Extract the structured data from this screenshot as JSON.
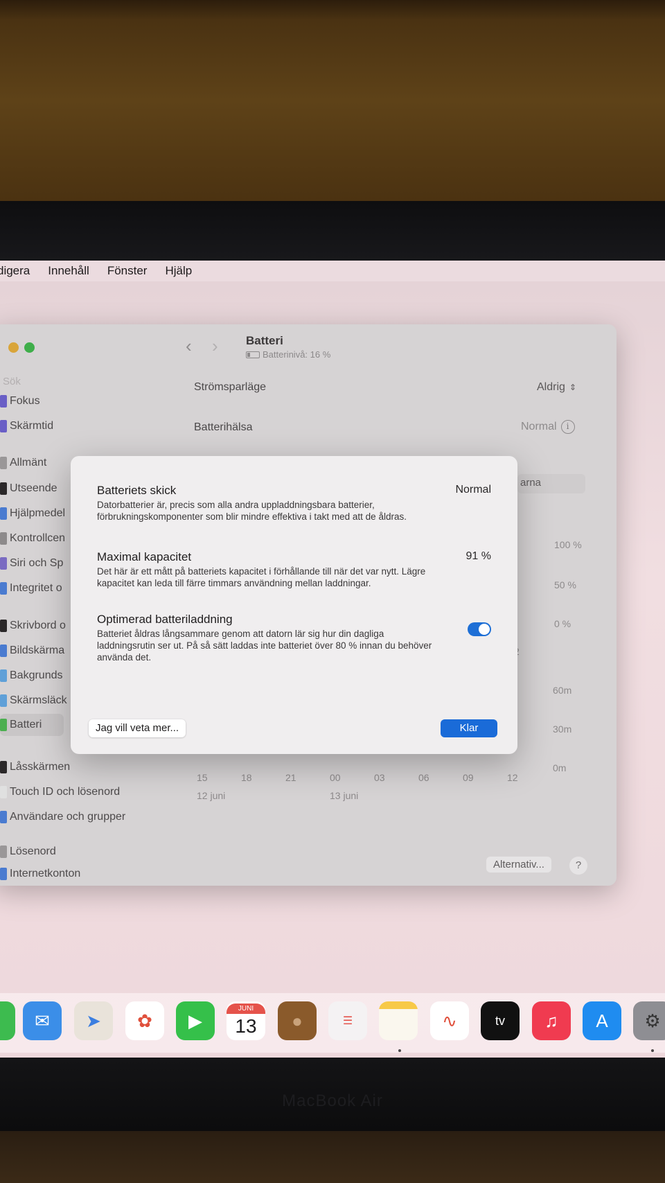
{
  "menubar": [
    "digera",
    "Innehåll",
    "Fönster",
    "Hjälp"
  ],
  "window": {
    "title": "Batteri",
    "subtitle": "Batterinivå: 16 %",
    "search_placeholder": "Sök",
    "sidebar": [
      "Fokus",
      "Skärmtid",
      "Allmänt",
      "Utseende",
      "Hjälpmedel",
      "Kontrollcen",
      "Siri och Sp",
      "Integritet o",
      "Skrivbord o",
      "Bildskärma",
      "Bakgrunds",
      "Skärmsläck",
      "Batteri",
      "Låsskärmen",
      "Touch ID och lösenord",
      "Användare och grupper",
      "Lösenord",
      "Internetkonton"
    ],
    "low_power_label": "Strömsparläge",
    "low_power_value": "Aldrig",
    "health_label": "Batterihälsa",
    "health_value": "Normal",
    "partial_label": "arna",
    "chart": {
      "level_ticks": [
        "100 %",
        "50 %",
        "0 %"
      ],
      "usage_ticks": [
        "60m",
        "30m",
        "0m"
      ],
      "hours": [
        "15",
        "18",
        "21",
        "00",
        "03",
        "06",
        "09",
        "12"
      ],
      "dates": [
        "12 juni",
        "13 juni"
      ],
      "partial_tick": "2"
    },
    "options_button": "Alternativ...",
    "help_button": "?"
  },
  "modal": {
    "condition_title": "Batteriets skick",
    "condition_value": "Normal",
    "condition_desc": "Datorbatterier är, precis som alla andra uppladdningsbara batterier, förbrukningskomponenter som blir mindre effektiva i takt med att de åldras.",
    "capacity_title": "Maximal kapacitet",
    "capacity_value": "91 %",
    "capacity_desc": "Det här är ett mått på batteriets kapacitet i förhållande till när det var nytt. Lägre kapacitet kan leda till färre timmars användning mellan laddningar.",
    "optimized_title": "Optimerad batteriladdning",
    "optimized_on": true,
    "optimized_desc": "Batteriet åldras långsammare genom att datorn lär sig hur din dagliga laddningsrutin ser ut. På så sätt laddas inte batteriet över 80 % innan du behöver använda det.",
    "learn_more": "Jag vill veta mer...",
    "done": "Klar"
  },
  "dock": {
    "calendar_month": "JUNI",
    "calendar_day": "13",
    "tv_label": "tv",
    "apps": [
      "messages-icon",
      "mail-icon",
      "maps-icon",
      "photos-icon",
      "facetime-icon",
      "calendar-icon",
      "contacts-icon",
      "reminders-icon",
      "notes-icon",
      "freeform-icon",
      "apple-tv-icon",
      "music-icon",
      "app-store-icon",
      "system-settings-icon"
    ]
  },
  "hardware": {
    "brand": "MacBook Air"
  }
}
